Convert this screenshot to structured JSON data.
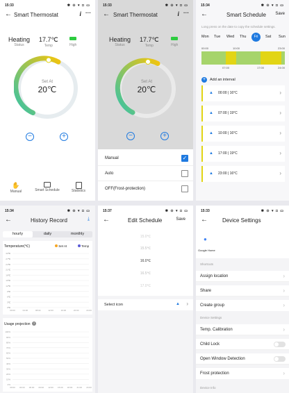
{
  "p1": {
    "time": "15:33",
    "status_icons": "✱ ⊙ ▾ ◘ ▭",
    "title": "Smart Thermostat",
    "info_icon": "i",
    "more_icon": "···",
    "mode_value": "Heating",
    "mode_label": "Status",
    "temp_value": "17.7℃",
    "temp_label": "Temp",
    "battery_label": "High",
    "dial_label": "Set At",
    "dial_value": "20℃",
    "minus": "−",
    "plus": "+",
    "nav": [
      "Manual",
      "Smart Schedule",
      "Statistics"
    ]
  },
  "p2": {
    "time": "15:33",
    "status_icons": "✱ ⊙ ▾ ◘ ▭",
    "title": "Smart Thermostat",
    "info_icon": "i",
    "more_icon": "···",
    "mode_value": "Heating",
    "mode_label": "Status",
    "temp_value": "17.7℃",
    "temp_label": "Temp",
    "battery_label": "High",
    "dial_label": "Set At",
    "dial_value": "20℃",
    "minus": "−",
    "plus": "+",
    "options": [
      {
        "label": "Manual",
        "checked": true
      },
      {
        "label": "Auto",
        "checked": false
      },
      {
        "label": "OFF(Frost-protection)",
        "checked": false
      }
    ]
  },
  "p3": {
    "time": "15:34",
    "status_icons": "✱ ⊙ ▾ ◘ ▭",
    "title": "Smart Schedule",
    "save": "Save",
    "hint": "Long press on the date to copy the schedule settings.",
    "days": [
      "Mon",
      "Tue",
      "Wed",
      "Thu",
      "Fri",
      "Sat",
      "Sun"
    ],
    "active_day": "Fri",
    "timeline_top": [
      "00:00",
      "10:00",
      "23:00"
    ],
    "timeline_bottom": [
      "07:00",
      "17:00",
      "24:00"
    ],
    "add_interval": "Add an interval",
    "intervals": [
      "00:00 | 16°C",
      "07:00 | 19°C",
      "10:00 | 16°C",
      "17:00 | 19°C",
      "23:00 | 16°C"
    ]
  },
  "p4": {
    "time": "15:34",
    "status_icons": "✱ ⊙ ▾ ◘ ▭",
    "title": "History Record",
    "tabs": [
      "hourly",
      "daily",
      "monthly"
    ],
    "temp_title": "Temperature(℃)",
    "legend": [
      "Set At",
      "Temp"
    ],
    "temp_ticks": [
      "30℃",
      "27℃",
      "24℃",
      "21℃",
      "18℃",
      "15℃",
      "12℃",
      "9℃",
      "6℃",
      "3℃",
      "0℃"
    ],
    "x_ticks": [
      "00:00",
      "04:00",
      "08:00",
      "12:00",
      "16:00",
      "20:00",
      "24:00"
    ],
    "usage_title": "Usage projection",
    "usage_ticks": [
      "100%",
      "90%",
      "80%",
      "70%",
      "60%",
      "50%",
      "40%",
      "30%",
      "20%",
      "10%",
      "0%"
    ],
    "usage_x": [
      "00:00",
      "03:00",
      "06:00",
      "09:00",
      "12:00",
      "15:00",
      "18:00",
      "21:00",
      "24:00"
    ]
  },
  "p5": {
    "time": "15:37",
    "status_icons": "✱ ⊙ ▾ ◘ ▭",
    "title": "Edit Schedule",
    "save": "Save",
    "picker": [
      "15.0℃",
      "15.5℃",
      "16.0℃",
      "16.5℃",
      "17.0℃"
    ],
    "select_icon": "Select icon"
  },
  "p6": {
    "time": "15:33",
    "status_icons": "✱ ⊙ ▾ ◘ ▭",
    "title": "Device Settings",
    "google_home": "Google Home",
    "sec_shortcuts": "Shortcuts",
    "shortcut_items": [
      "Assign location",
      "Share",
      "Create group"
    ],
    "sec_device": "Device Settings",
    "device_items": [
      "Temp. Calibration",
      "Child Lock",
      "Open Window Detection",
      "Frost protection"
    ],
    "sec_info": "Device Info"
  },
  "colors": {
    "accent": "#1f7ae0",
    "ring_start": "#34c3a8",
    "ring_end": "#f1c40f",
    "track": "#e6ecef",
    "schedule_yellow": "#e2d515",
    "schedule_green": "#a6d46b",
    "dim": "#999999",
    "dimmed_bg": "#d9d9d9"
  }
}
